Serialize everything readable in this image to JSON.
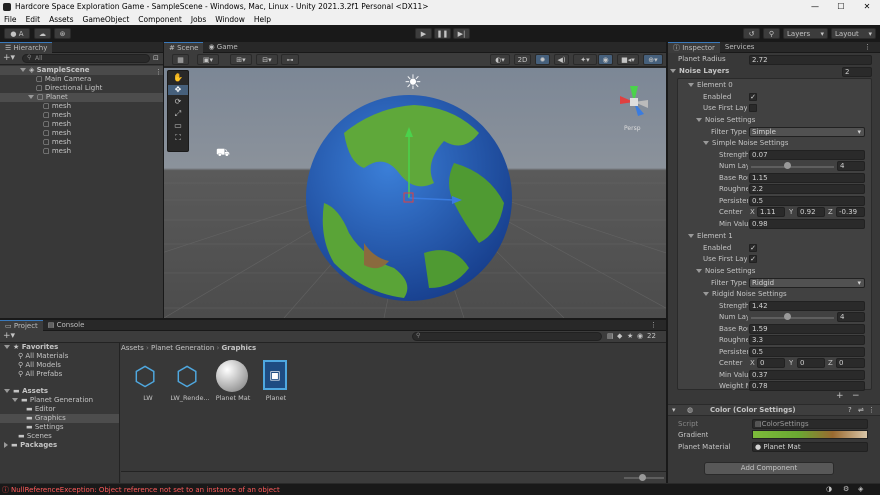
{
  "window": {
    "title": "Hardcore Space Exploration Game - SampleScene - Windows, Mac, Linux - Unity 2021.3.2f1 Personal <DX11>"
  },
  "menu": [
    "File",
    "Edit",
    "Assets",
    "GameObject",
    "Component",
    "Jobs",
    "Window",
    "Help"
  ],
  "toolbar": {
    "account": "A",
    "layers": "Layers",
    "layout": "Layout"
  },
  "hierarchy": {
    "tab": "Hierarchy",
    "search_placeholder": "All",
    "items": [
      {
        "label": "SampleScene"
      },
      {
        "label": "Main Camera"
      },
      {
        "label": "Directional Light"
      },
      {
        "label": "Planet"
      },
      {
        "label": "mesh"
      },
      {
        "label": "mesh"
      },
      {
        "label": "mesh"
      },
      {
        "label": "mesh"
      },
      {
        "label": "mesh"
      },
      {
        "label": "mesh"
      }
    ]
  },
  "scene": {
    "tab_scene": "Scene",
    "tab_game": "Game",
    "mode_2d": "2D",
    "persp": "Persp"
  },
  "inspector": {
    "tab": "Inspector",
    "tab2": "Services",
    "planet_radius_label": "Planet Radius",
    "planet_radius": "2.72",
    "noise_layers_label": "Noise Layers",
    "noise_layers": "2",
    "e0": {
      "title": "Element 0",
      "enabled": "Enabled",
      "use_first": "Use First Laye",
      "noise_settings": "Noise Settings",
      "filter_type_label": "Filter Type",
      "filter_type": "Simple",
      "sub": "Simple Noise Settings",
      "strength_l": "Strength",
      "strength": "0.07",
      "numlay_l": "Num Lay",
      "numlay": "4",
      "baser_l": "Base Rou",
      "baser": "1.15",
      "rough_l": "Roughne",
      "rough": "2.2",
      "pers_l": "Persister",
      "pers": "0.5",
      "center_l": "Center",
      "cx": "1.11",
      "cy": "0.92",
      "cz": "-0.39",
      "minv_l": "Min Valu",
      "minv": "0.98"
    },
    "e1": {
      "title": "Element 1",
      "enabled": "Enabled",
      "use_first": "Use First Laye",
      "noise_settings": "Noise Settings",
      "filter_type_label": "Filter Type",
      "filter_type": "Ridgid",
      "sub": "Ridgid Noise Settings",
      "strength_l": "Strength",
      "strength": "1.42",
      "numlay_l": "Num Lay",
      "numlay": "4",
      "baser_l": "Base Rou",
      "baser": "1.59",
      "rough_l": "Roughne",
      "rough": "3.3",
      "pers_l": "Persister",
      "pers": "0.5",
      "center_l": "Center",
      "cx": "0",
      "cy": "0",
      "cz": "0",
      "minv_l": "Min Valu",
      "minv": "0.37",
      "weight_l": "Weight M",
      "weight": "0.78"
    },
    "color": {
      "title": "Color (Color Settings)",
      "script_l": "Script",
      "script": "ColorSettings",
      "gradient_l": "Gradient",
      "mat_l": "Planet Material",
      "mat": "Planet Mat"
    },
    "add_component": "Add Component"
  },
  "project": {
    "tab": "Project",
    "tab2": "Console",
    "count": "22",
    "tree": [
      {
        "label": "Favorites"
      },
      {
        "label": "All Materials"
      },
      {
        "label": "All Models"
      },
      {
        "label": "All Prefabs"
      },
      {
        "label": "Assets"
      },
      {
        "label": "Planet Generation"
      },
      {
        "label": "Editor"
      },
      {
        "label": "Graphics"
      },
      {
        "label": "Settings"
      },
      {
        "label": "Scenes"
      },
      {
        "label": "Packages"
      }
    ],
    "breadcrumb": [
      "Assets",
      "Planet Generation",
      "Graphics"
    ],
    "assets": [
      {
        "label": "LW"
      },
      {
        "label": "LW_Rende..."
      },
      {
        "label": "Planet Mat"
      },
      {
        "label": "Planet"
      }
    ]
  },
  "status": {
    "error": "NullReferenceException: Object reference not set to an instance of an object"
  }
}
